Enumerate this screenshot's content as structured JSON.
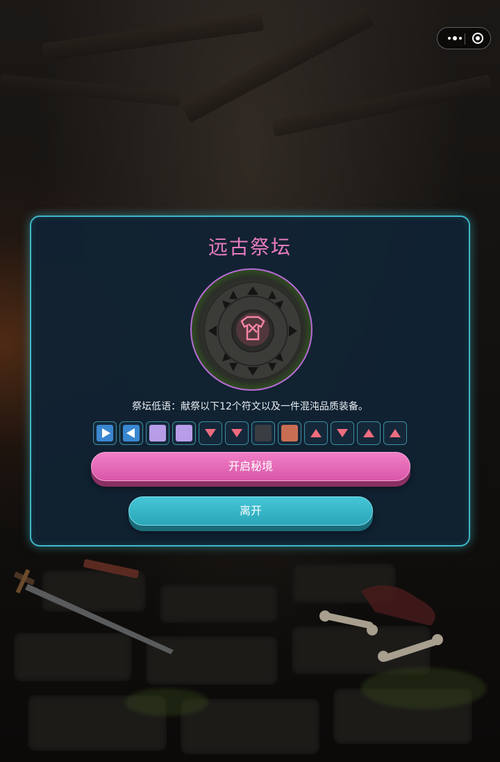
{
  "dialog": {
    "title": "远古祭坛",
    "description": "祭坛低语：献祭以下12个符文以及一件混沌品质装备。",
    "altar_image": "altar-rune-circle",
    "runes": [
      {
        "icon": "arrow-right-icon",
        "color": "#3a87d0"
      },
      {
        "icon": "arrow-left-icon",
        "color": "#3a87d0"
      },
      {
        "icon": "purple-square",
        "color": "#b79de8"
      },
      {
        "icon": "purple-square",
        "color": "#b79de8"
      },
      {
        "icon": "triangle-down-icon",
        "color": "#ee6c7e"
      },
      {
        "icon": "triangle-down-icon",
        "color": "#ee6c7e"
      },
      {
        "icon": "dark-square",
        "color": "#3a3d42"
      },
      {
        "icon": "orange-square",
        "color": "#c96e52"
      },
      {
        "icon": "triangle-up-icon",
        "color": "#ee6c7e"
      },
      {
        "icon": "triangle-down-icon",
        "color": "#ee6c7e"
      },
      {
        "icon": "triangle-up-icon",
        "color": "#ee6c7e"
      },
      {
        "icon": "triangle-up-icon",
        "color": "#ee6c7e"
      }
    ],
    "open_button": "开启秘境",
    "leave_button": "离开"
  },
  "colors": {
    "title": "#e87cc0",
    "border": "#3fb9c9",
    "open_button": "#e46ab6",
    "leave_button": "#36b6c7"
  }
}
